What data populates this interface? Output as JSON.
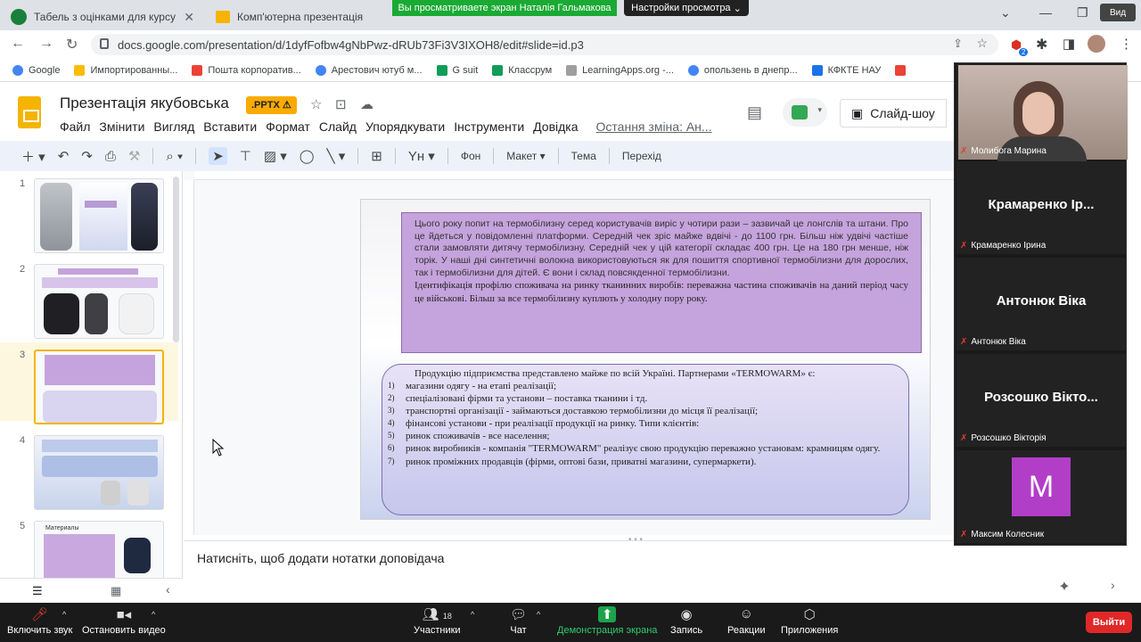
{
  "browser": {
    "tabs": [
      {
        "title": "Табель з оцінками для курсу \"Ф",
        "active": false
      },
      {
        "title": "Комп'ютерна презентація",
        "active": false
      },
      {
        "title": "Презентація якубовська",
        "active": true
      }
    ],
    "url": "docs.google.com/presentation/d/1dyfFofbw4gNbPwz-dRUb73Fi3V3IXOH8/edit#slide=id.p3",
    "bookmarks": [
      "Google",
      "Импортированны...",
      "Пошта корпоратив...",
      "Арестович ютуб м...",
      "G suit",
      "Классрум",
      "LearningApps.org -...",
      "опользень в днепр...",
      "КФКТЕ НАУ"
    ],
    "extension_badge": "2"
  },
  "zoom_share": {
    "banner": "Вы просматриваете экран Наталія Гальмакова",
    "view_options": "Настройки просмотра",
    "corner_label": "Вид"
  },
  "docs": {
    "title": "Презентація якубовська",
    "badge": ".PPTX",
    "menu": [
      "Файл",
      "Змінити",
      "Вигляд",
      "Вставити",
      "Формат",
      "Слайд",
      "Упорядкувати",
      "Інструменти",
      "Довідка"
    ],
    "last_edit": "Остання зміна: Ан...",
    "slideshow": "Слайд-шоу",
    "toolbar": {
      "background": "Фон",
      "layout": "Макет",
      "theme": "Тема",
      "transition": "Перехід"
    },
    "notes_placeholder": "Натисніть, щоб додати нотатки доповідача"
  },
  "filmstrip": {
    "slides": [
      "1",
      "2",
      "3",
      "4",
      "5"
    ],
    "selected": "3",
    "slide5_title": "Материалы"
  },
  "slide": {
    "box1_text": "Цього року попит на термобілизну серед користувачів виріс у чотири рази – зазвичай це лонгслів та штани. Про це йдеться у повідомленні платформи. Середній чек зріс майже вдвічі - до 1100 грн. Більш ніж удвічі частіше стали замовляти дитячу термобілизну. Середній чек у цій категорії складає 400 грн. Це на 180 грн менше, ніж торік. У наші дні синтетичні волокна використовуються як для пошиття спортивної термобілизни для дорослих, так і термобілизни для дітей. Є вони і склад повсякденної термобілизни.",
    "box1_extra": "Ідентифікація профілю споживача на ринку тканинних виробів: переважна частина споживачів на даний період часу це військові. Більш за все термобілизну куплють у холодну пору року.",
    "box2_intro": "Продукцію підприємства представлено майже по всій Україні. Партнерами «TERMOWARM» є:",
    "box2_items": [
      {
        "n": "1)",
        "text": "магазини одягу - на етапі реалізації;"
      },
      {
        "n": "2)",
        "text": "спеціалізовані фірми та установи – поставка тканини і тд."
      },
      {
        "n": "3)",
        "text": "транспортні організації - займаються доставкою термобілизни до місця її реалізації;"
      },
      {
        "n": "4)",
        "text": "фінансові установи - при реалізації продукції на ринку. Типи клієнтів:"
      },
      {
        "n": "5)",
        "text": "ринок споживачів - все населення;"
      },
      {
        "n": "6)",
        "text": "ринок виробників - компанія \"TERMOWARM\" реалізує свою продукцію переважно установам: крамницям одягу."
      },
      {
        "n": "7)",
        "text": "ринок проміжних продавців (фірми, оптові бази, приватні магазини, супермаркети)."
      }
    ]
  },
  "participants": [
    {
      "name": "Молибога Марина",
      "big": "",
      "type": "camera"
    },
    {
      "name": "Крамаренко Ірина",
      "big": "Крамаренко Ір...",
      "type": "name"
    },
    {
      "name": "Антонюк Віка",
      "big": "Антонюк Віка",
      "type": "name"
    },
    {
      "name": "Розсошко Вікторія",
      "big": "Розсошко Вікто...",
      "type": "name"
    },
    {
      "name": "Максим Колесник",
      "big": "M",
      "type": "avatar"
    }
  ],
  "zoom_bar": {
    "mute": "Включить звук",
    "video": "Остановить видео",
    "participants": "Участники",
    "participants_count": "18",
    "chat": "Чат",
    "share": "Демонстрация экрана",
    "record": "Запись",
    "reactions": "Реакции",
    "apps": "Приложения",
    "leave": "Выйти"
  }
}
